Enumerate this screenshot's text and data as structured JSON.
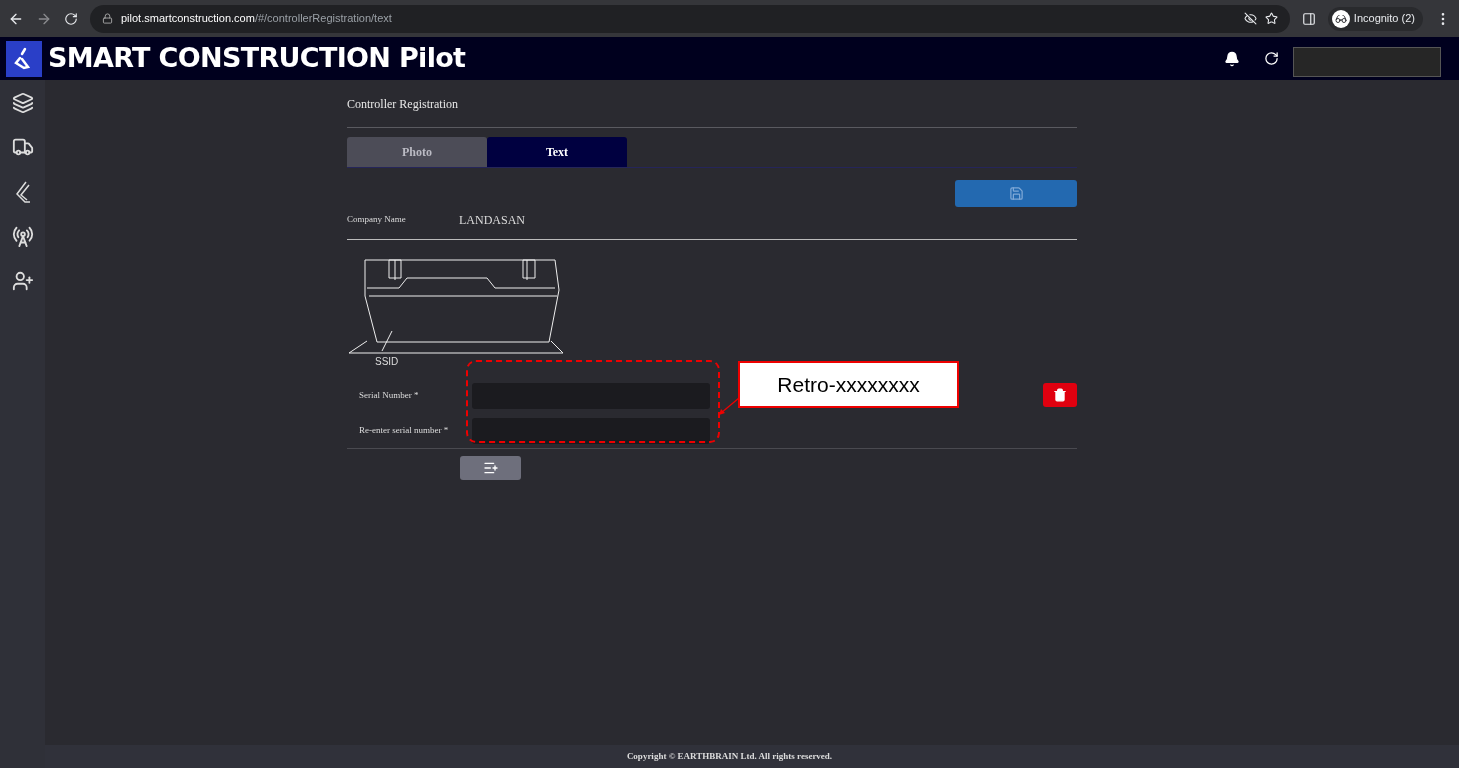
{
  "browser": {
    "url_host": "pilot.smartconstruction.com",
    "url_path": "/#/controllerRegistration/text",
    "profile": "Incognito (2)"
  },
  "app": {
    "title": "SMART CONSTRUCTION Pilot"
  },
  "page": {
    "heading": "Controller Registration",
    "tabs": [
      {
        "label": "Photo",
        "selected": false
      },
      {
        "label": "Text",
        "selected": true
      }
    ],
    "company": {
      "label": "Company Name",
      "value": "LANDASAN"
    },
    "image_label": "SSID",
    "fields": [
      {
        "label": "Serial Number *"
      },
      {
        "label": "Re-enter serial number *"
      }
    ],
    "annotation": "Retro-xxxxxxxx"
  },
  "footer": "Copyright © EARTHBRAIN Ltd. All rights reserved."
}
